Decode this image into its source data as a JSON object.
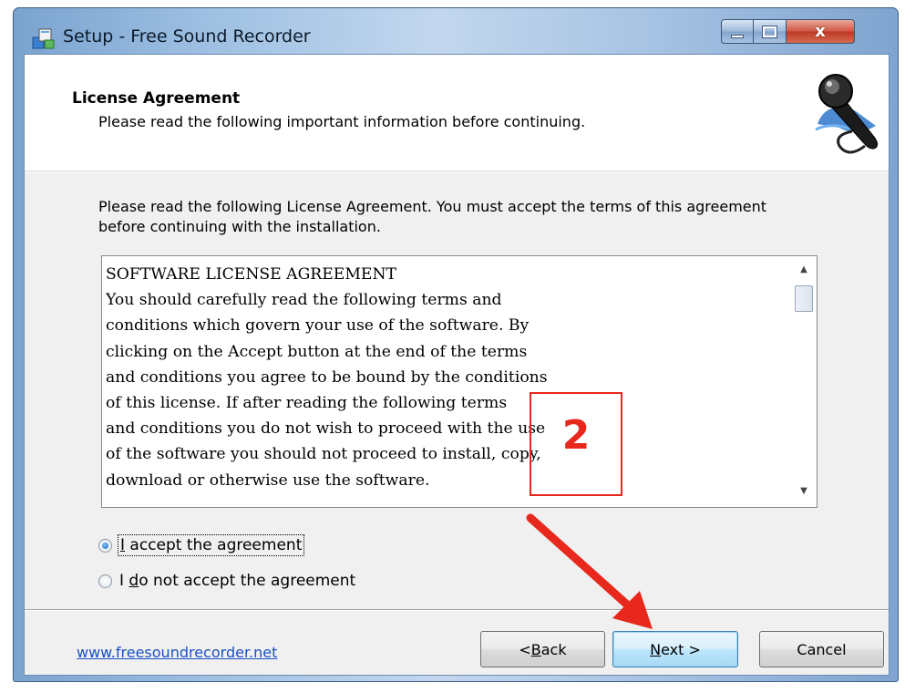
{
  "window": {
    "title": "Setup - Free Sound Recorder",
    "close_glyph": "x"
  },
  "header": {
    "title": "License Agreement",
    "subtitle": "Please read the following important information before continuing.",
    "logo_icon": "microphone-icon"
  },
  "intro": "Please read the following License Agreement. You must accept the terms of this agreement before continuing with the installation.",
  "license": {
    "lines": [
      "SOFTWARE LICENSE AGREEMENT",
      "",
      "You should carefully read the following terms and",
      "conditions which govern your use of the software. By",
      "clicking on the Accept button at the end of the terms",
      "and conditions you agree to be bound by the conditions",
      "of this license. If after reading the following terms",
      "and conditions you do not wish to proceed with the use",
      "of the software you should not proceed to install, copy,",
      "download or otherwise use the software."
    ]
  },
  "options": {
    "accept_prefix": "",
    "accept_mnemonic": "I",
    "accept_rest": " accept the agreement",
    "decline_prefix": "I ",
    "decline_mnemonic": "d",
    "decline_rest": "o not accept the agreement",
    "selected": "accept"
  },
  "footer": {
    "link": "www.freesoundrecorder.net",
    "back_prefix": "< ",
    "back_mnemonic": "B",
    "back_rest": "ack",
    "next_mnemonic": "N",
    "next_rest": "ext >",
    "cancel": "Cancel"
  },
  "annotation": {
    "step_number": "2",
    "color": "#e8281c"
  },
  "colors": {
    "link": "#1a4fc4",
    "next_button_border": "#3c7fb1"
  }
}
